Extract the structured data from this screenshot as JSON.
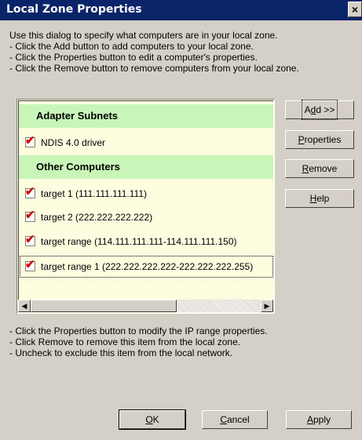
{
  "window": {
    "title": "Local Zone Properties",
    "close_glyph": "×"
  },
  "instructions": [
    "Use this dialog to specify what computers are in your local zone.",
    "- Click the Add button to add computers to your local zone.",
    "- Click the Properties button to edit a computer's properties.",
    "- Click the Remove button to remove computers from your local zone."
  ],
  "list": {
    "group_adapter": "Adapter Subnets",
    "group_other": "Other Computers",
    "items": [
      {
        "label": "NDIS 4.0 driver",
        "checked": true
      },
      {
        "label": "target 1 (111.111.111.111)",
        "checked": true
      },
      {
        "label": "target 2 (222.222.222.222)",
        "checked": true
      },
      {
        "label": "target range (114.111.111.111-114.111.111.150)",
        "checked": true
      },
      {
        "label": "target range 1 (222.222.222.222-222.222.222.255)",
        "checked": true
      }
    ],
    "check_glyph": "✔",
    "scroll_left": "◀",
    "scroll_right": "▶"
  },
  "buttons": {
    "add_pre": "A",
    "add_mnemonic": "d",
    "add_post": "d >>",
    "properties_mnemonic": "P",
    "properties_post": "roperties",
    "remove_mnemonic": "R",
    "remove_post": "emove",
    "help_mnemonic": "H",
    "help_post": "elp",
    "ok_mnemonic": "O",
    "ok_post": "K",
    "cancel_mnemonic": "C",
    "cancel_post": "ancel",
    "apply_mnemonic": "A",
    "apply_post": "pply"
  },
  "notes": [
    "- Click the Properties button to modify the IP range properties.",
    "- Click Remove to remove this item from the local zone.",
    "- Uncheck to exclude this item from the local network."
  ],
  "colors": {
    "titlebar": "#0a246a",
    "group_header": "#c8f5b8",
    "list_bg": "#fdfde0",
    "check": "#d00000"
  }
}
